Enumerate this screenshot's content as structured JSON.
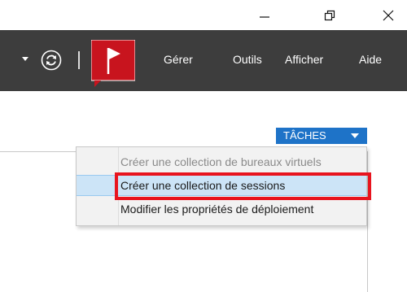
{
  "window_controls": {
    "minimize_icon": "minimize-icon",
    "restore_icon": "restore-icon",
    "close_icon": "close-icon"
  },
  "toolbar": {
    "menu": [
      {
        "label": "Gérer"
      },
      {
        "label": "Outils"
      },
      {
        "label": "Afficher"
      },
      {
        "label": "Aide"
      }
    ],
    "flag_color": "#c8141e",
    "background": "#3d3d3d"
  },
  "tasks": {
    "label": "TÂCHES",
    "color": "#1e73c8"
  },
  "dropdown": {
    "items": [
      {
        "label": "Créer une collection de bureaux virtuels",
        "state": "disabled"
      },
      {
        "label": "Créer une collection de sessions",
        "state": "hover"
      },
      {
        "label": "Modifier les propriétés de déploiement",
        "state": "normal"
      }
    ]
  },
  "annotation": {
    "color": "#e8141e"
  }
}
